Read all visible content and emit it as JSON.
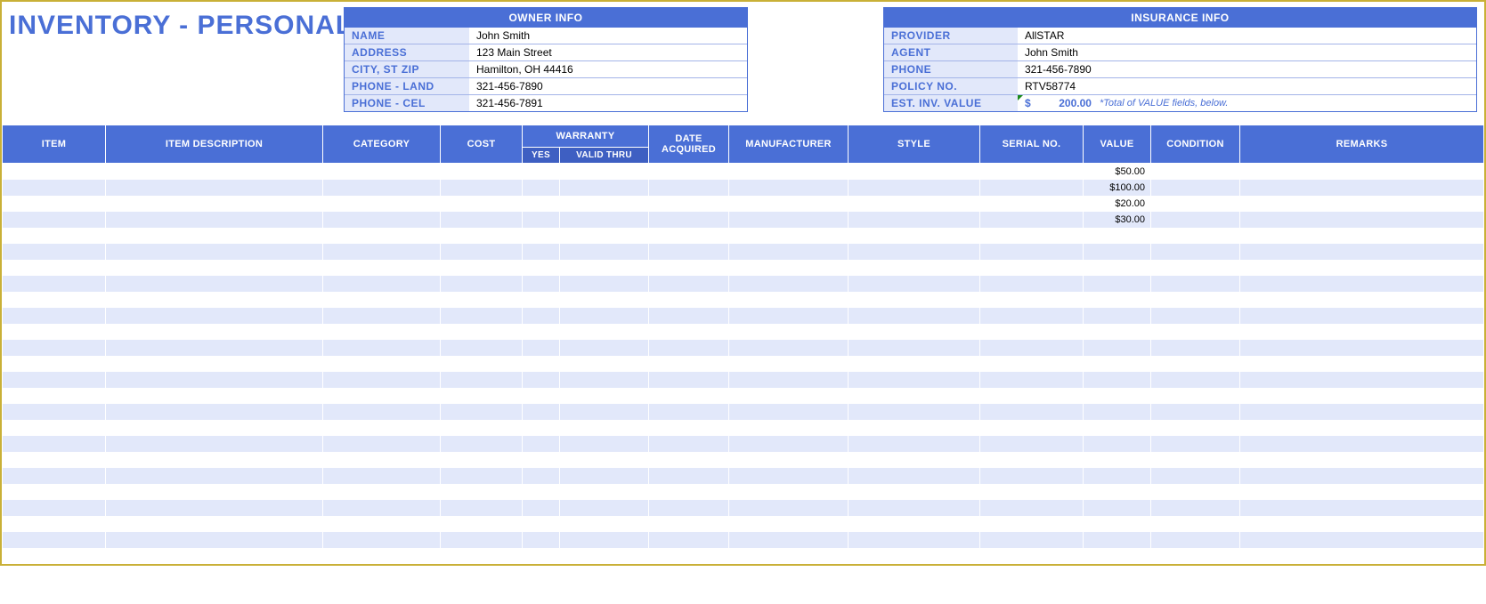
{
  "title": "INVENTORY - PERSONAL",
  "owner": {
    "heading": "OWNER INFO",
    "rows": [
      {
        "label": "NAME",
        "value": "John Smith"
      },
      {
        "label": "ADDRESS",
        "value": "123 Main Street"
      },
      {
        "label": "CITY, ST  ZIP",
        "value": "Hamilton, OH  44416"
      },
      {
        "label": "PHONE - LAND",
        "value": "321-456-7890"
      },
      {
        "label": "PHONE - CEL",
        "value": "321-456-7891"
      }
    ]
  },
  "insurance": {
    "heading": "INSURANCE INFO",
    "rows": [
      {
        "label": "PROVIDER",
        "value": "AllSTAR"
      },
      {
        "label": "AGENT",
        "value": "John Smith"
      },
      {
        "label": "PHONE",
        "value": "321-456-7890"
      },
      {
        "label": "POLICY NO.",
        "value": "RTV58774"
      }
    ],
    "est_label": "EST. INV. VALUE",
    "est_currency": "$",
    "est_amount": "200.00",
    "est_note": "*Total of VALUE fields, below."
  },
  "columns": {
    "item": "ITEM",
    "description": "ITEM DESCRIPTION",
    "category": "CATEGORY",
    "cost": "COST",
    "warranty": "WARRANTY",
    "warranty_yes": "YES",
    "warranty_thru": "VALID THRU",
    "date_acquired": "DATE ACQUIRED",
    "manufacturer": "MANUFACTURER",
    "style": "STYLE",
    "serial": "SERIAL NO.",
    "value": "VALUE",
    "condition": "CONDITION",
    "remarks": "REMARKS"
  },
  "rows": [
    {
      "value": "$50.00"
    },
    {
      "value": "$100.00"
    },
    {
      "value": "$20.00"
    },
    {
      "value": "$30.00"
    },
    {},
    {},
    {},
    {},
    {},
    {},
    {},
    {},
    {},
    {},
    {},
    {},
    {},
    {},
    {},
    {},
    {},
    {},
    {},
    {},
    {}
  ]
}
